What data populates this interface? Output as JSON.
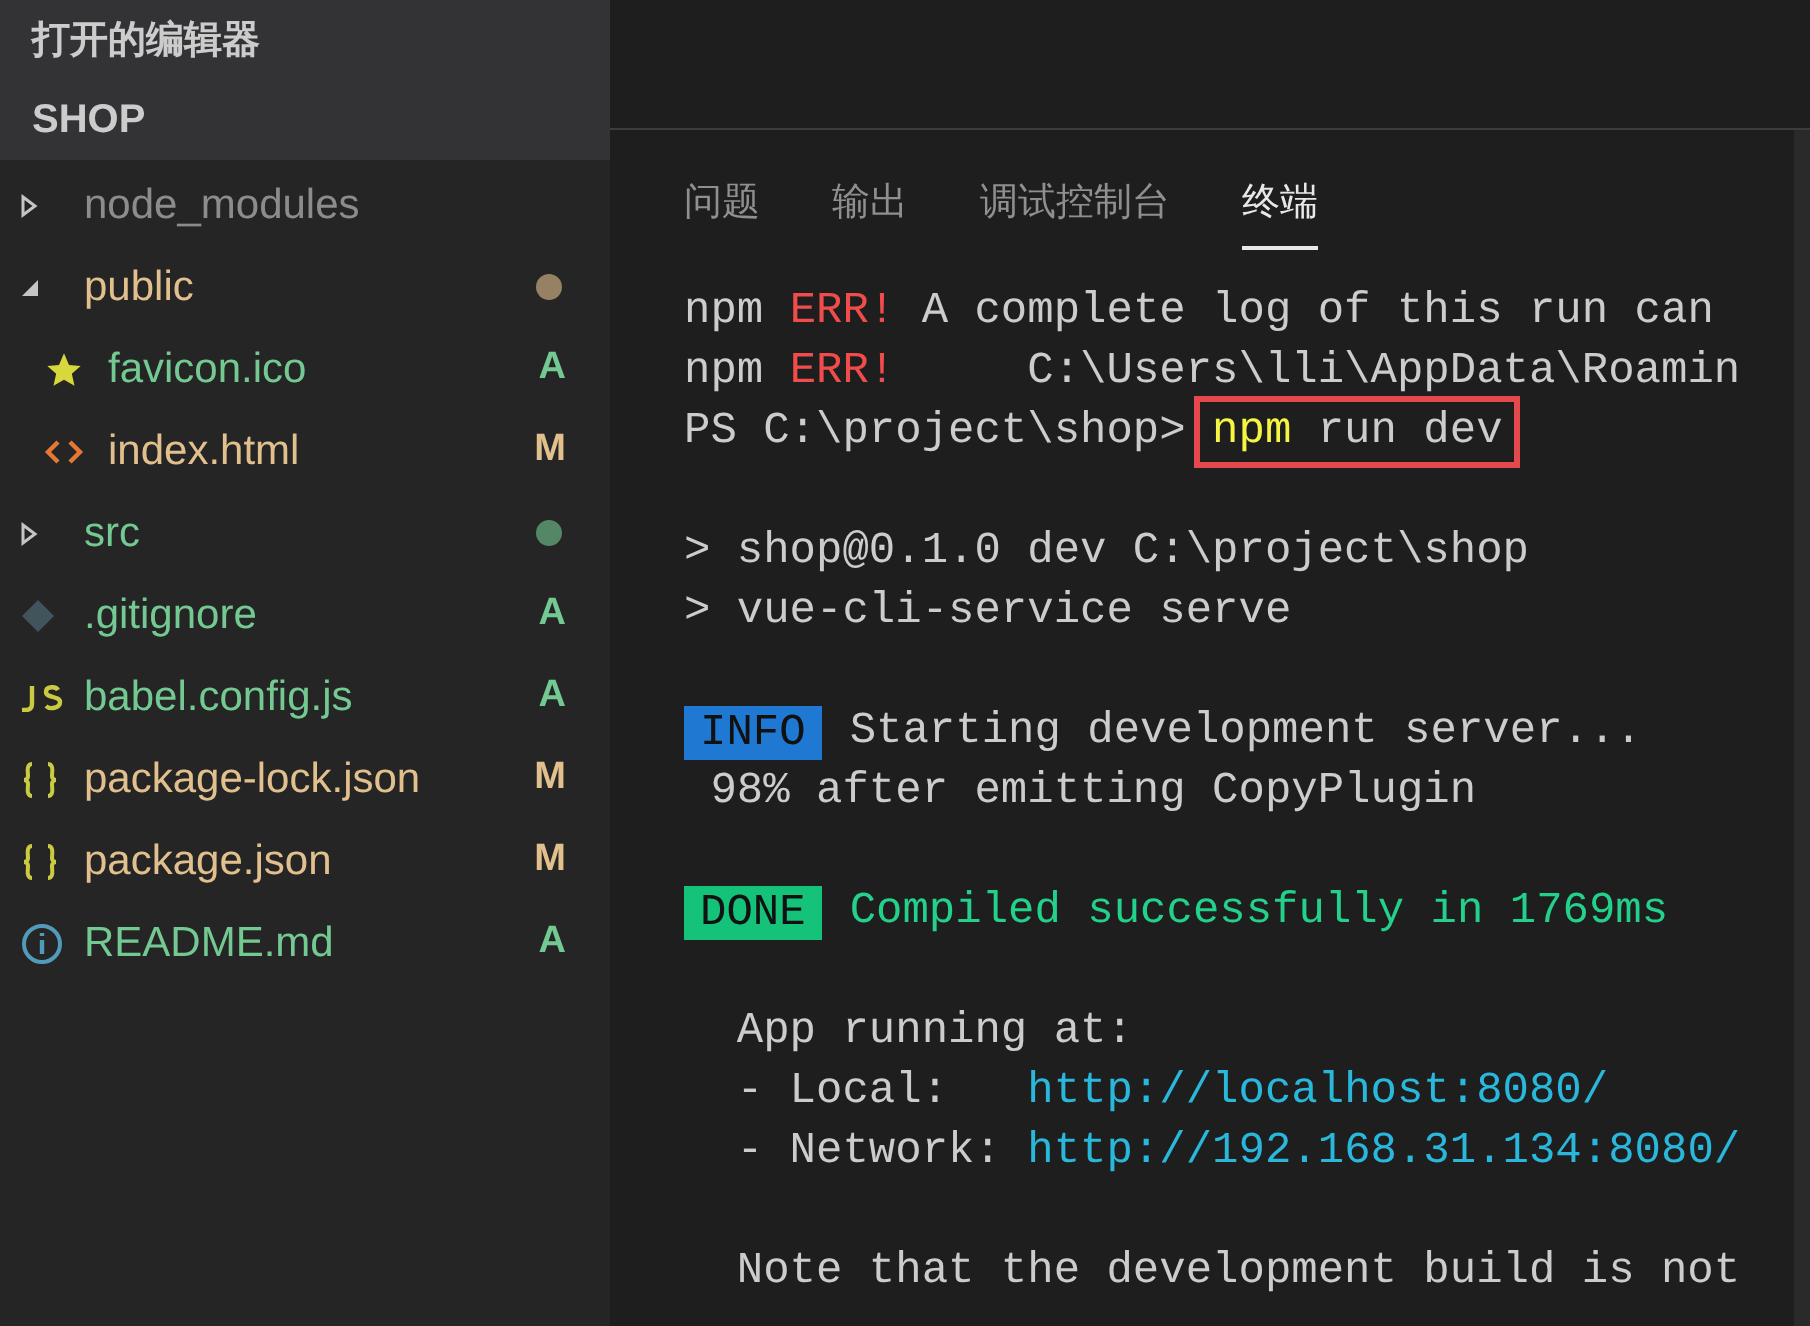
{
  "sidebar": {
    "open_editors_title": "打开的编辑器",
    "folder_title": "SHOP",
    "items": [
      {
        "kind": "folder",
        "name": "node_modules",
        "expanded": false,
        "color": "#8c8c8c"
      },
      {
        "kind": "folder",
        "name": "public",
        "expanded": true,
        "color": "#e2c08d",
        "dot": true,
        "children": [
          {
            "kind": "image",
            "name": "favicon.ico",
            "status": "A",
            "color": "#73c991"
          },
          {
            "kind": "html",
            "name": "index.html",
            "status": "M",
            "color": "#e2c08d"
          }
        ]
      },
      {
        "kind": "folder",
        "name": "src",
        "expanded": false,
        "color": "#73c991",
        "dot": true
      },
      {
        "kind": "git",
        "name": ".gitignore",
        "status": "A",
        "color": "#73c991"
      },
      {
        "kind": "js",
        "name": "babel.config.js",
        "status": "A",
        "color": "#73c991"
      },
      {
        "kind": "json",
        "name": "package-lock.json",
        "status": "M",
        "color": "#e2c08d"
      },
      {
        "kind": "json",
        "name": "package.json",
        "status": "M",
        "color": "#e2c08d"
      },
      {
        "kind": "markdown",
        "name": "README.md",
        "status": "A",
        "color": "#73c991"
      }
    ]
  },
  "panel": {
    "tabs": [
      {
        "label": "问题",
        "selected": false
      },
      {
        "label": "输出",
        "selected": false
      },
      {
        "label": "调试控制台",
        "selected": false
      },
      {
        "label": "终端",
        "selected": true
      }
    ],
    "terminal": [
      {
        "kind": "error",
        "prefix": "npm ",
        "tag": "ERR!",
        "text": " A complete log of this run can"
      },
      {
        "kind": "error",
        "prefix": "npm ",
        "tag": "ERR!",
        "text": "     C:\\Users\\lli\\AppData\\Roamin"
      },
      {
        "kind": "prompt",
        "prefix": "PS C:\\project\\shop> ",
        "command": "npm",
        "args": " run dev",
        "highlighted": true
      },
      {
        "kind": "blank"
      },
      {
        "kind": "plain",
        "text": "> shop@0.1.0 dev C:\\project\\shop"
      },
      {
        "kind": "plain",
        "text": "> vue-cli-service serve"
      },
      {
        "kind": "blank"
      },
      {
        "kind": "badge",
        "badge": "INFO",
        "color": "#1f78d1",
        "text": "Starting development server...",
        "success": false
      },
      {
        "kind": "plain",
        "text": " 98% after emitting CopyPlugin"
      },
      {
        "kind": "blank"
      },
      {
        "kind": "badge",
        "badge": "DONE",
        "color": "#15c27a",
        "text": "Compiled successfully in 1769ms",
        "success": true
      },
      {
        "kind": "blank"
      },
      {
        "kind": "plain",
        "text": "  App running at:"
      },
      {
        "kind": "link",
        "label": "  - Local:   ",
        "url": "http://localhost:8080/"
      },
      {
        "kind": "link",
        "label": "  - Network: ",
        "url": "http://192.168.31.134:8080/"
      },
      {
        "kind": "blank"
      },
      {
        "kind": "plain",
        "text": "  Note that the development build is not"
      }
    ]
  }
}
